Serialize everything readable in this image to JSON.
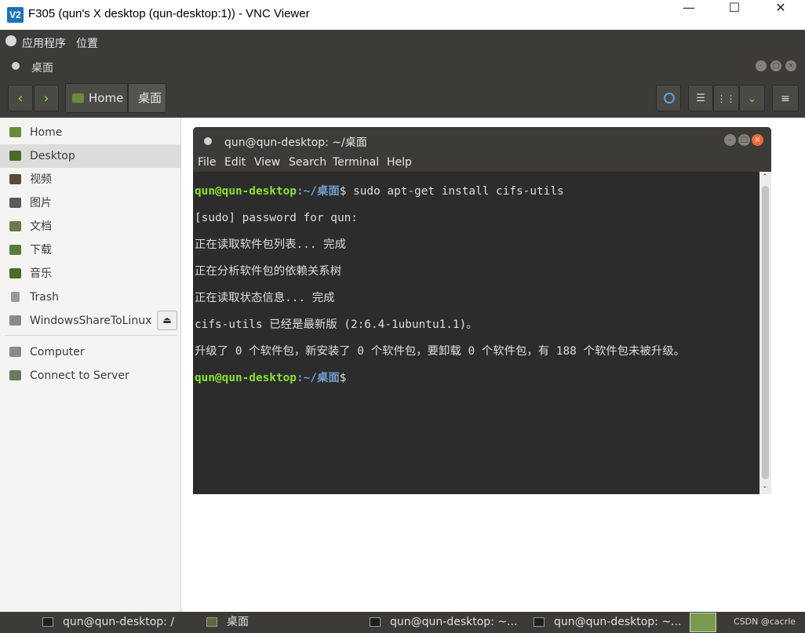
{
  "vnc": {
    "logo": "V2",
    "title": "F305 (qun's X desktop (qun-desktop:1)) - VNC Viewer",
    "minimize": "—",
    "maximize": "☐",
    "close": "✕"
  },
  "top_panel": {
    "apps": "应用程序",
    "places": "位置"
  },
  "nautilus": {
    "title": "桌面",
    "crumb_home": "Home",
    "crumb_current": "桌面"
  },
  "sidebar": {
    "items": [
      {
        "label": "Home"
      },
      {
        "label": "Desktop"
      },
      {
        "label": "视频"
      },
      {
        "label": "图片"
      },
      {
        "label": "文档"
      },
      {
        "label": "下载"
      },
      {
        "label": "音乐"
      },
      {
        "label": "Trash"
      },
      {
        "label": "WindowsShareToLinux"
      },
      {
        "label": "Computer"
      },
      {
        "label": "Connect to Server"
      }
    ]
  },
  "terminal": {
    "title": "qun@qun-desktop: ~/桌面",
    "menu": [
      "File",
      "Edit",
      "View",
      "Search",
      "Terminal",
      "Help"
    ],
    "prompt_user": "qun@qun-desktop",
    "prompt_path": ":~/桌面",
    "prompt_end": "$",
    "command": " sudo apt-get install cifs-utils",
    "output": [
      "[sudo] password for qun:",
      "正在读取软件包列表... 完成",
      "正在分析软件包的依赖关系树",
      "正在读取状态信息... 完成",
      "cifs-utils 已经是最新版 (2:6.4-1ubuntu1.1)。",
      "升级了 0 个软件包，新安装了 0 个软件包，要卸载 0 个软件包，有 188 个软件包未被升级。"
    ]
  },
  "taskbar": {
    "tasks": [
      {
        "label": "qun@qun-desktop: /"
      },
      {
        "label": "桌面"
      },
      {
        "label": "qun@qun-desktop: ~..."
      },
      {
        "label": "qun@qun-desktop: ~..."
      }
    ],
    "watermark": "CSDN @cacrle"
  }
}
